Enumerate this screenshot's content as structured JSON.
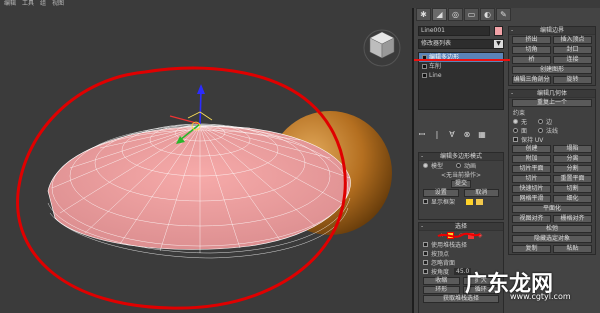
{
  "menubar": {
    "items": [
      "编辑",
      "工具",
      "组",
      "视图"
    ]
  },
  "viewport": {
    "name": "viewport-perspective"
  },
  "command_panel": {
    "tabs": [
      "✱",
      "◢",
      "◎",
      "▭",
      "◐",
      "✎"
    ],
    "object_name": "Line001",
    "object_color": "#f3a3a8",
    "modifier_list": "修改器列表",
    "stack": [
      {
        "label": "编辑多边形",
        "selected": true
      },
      {
        "label": "车削",
        "selected": false
      },
      {
        "label": "Line",
        "selected": false
      }
    ],
    "stack_icons": [
      "ꟷ",
      "|",
      "∀",
      "⊗",
      "▦"
    ],
    "edit_poly_mode": {
      "title": "编辑多边形模式",
      "model": "模型",
      "animate": "动画",
      "no_op": "<无当前操作>",
      "commit": "提交",
      "settings": "设置",
      "cancel": "取消",
      "show_cage": "显示框架"
    },
    "selection": {
      "title": "选择",
      "by_vertex": "使用堆栈选择",
      "by_vertex2": "按顶点",
      "ignore_back": "忽略背面",
      "by_angle": "按角度",
      "angle": "45.0",
      "shrink": "收缩",
      "grow": "扩大",
      "ring": "环形",
      "loop": "循环",
      "get_stack": "获取堆栈选择"
    },
    "edit_borders": {
      "title": "编辑边界",
      "extrude": "挤出",
      "insert_vertex": "插入顶点",
      "chamfer": "切角",
      "cap": "封口",
      "bridge": "桥",
      "connect": "连接",
      "create_shape": "创建图形",
      "edit_tri": "编辑三角剖分",
      "turn": "旋转"
    },
    "edit_geometry": {
      "title": "编辑几何体",
      "repeat": "重复上一个",
      "constraints": "约束",
      "none": "无",
      "edge": "边",
      "face": "面",
      "normal": "法线",
      "preserve_uv": "保持 UV",
      "create": "创建",
      "collapse": "塌陷",
      "attach": "附加",
      "detach": "分离",
      "slice_plane": "切片平面",
      "split": "分割",
      "slice": "切片",
      "reset_plane": "重置平面",
      "quickslice": "快速切片",
      "cut": "切割",
      "meshsmooth": "网格平滑",
      "tessellate": "细化",
      "make_planar": "平面化",
      "view_align": "视图对齐",
      "grid_align": "栅格对齐",
      "relax": "松弛",
      "hide_sel": "隐藏选定对象",
      "copy": "复制",
      "paste": "粘贴"
    }
  },
  "watermark": {
    "text": "广东龙网",
    "url": "www.cgtyl.com"
  }
}
